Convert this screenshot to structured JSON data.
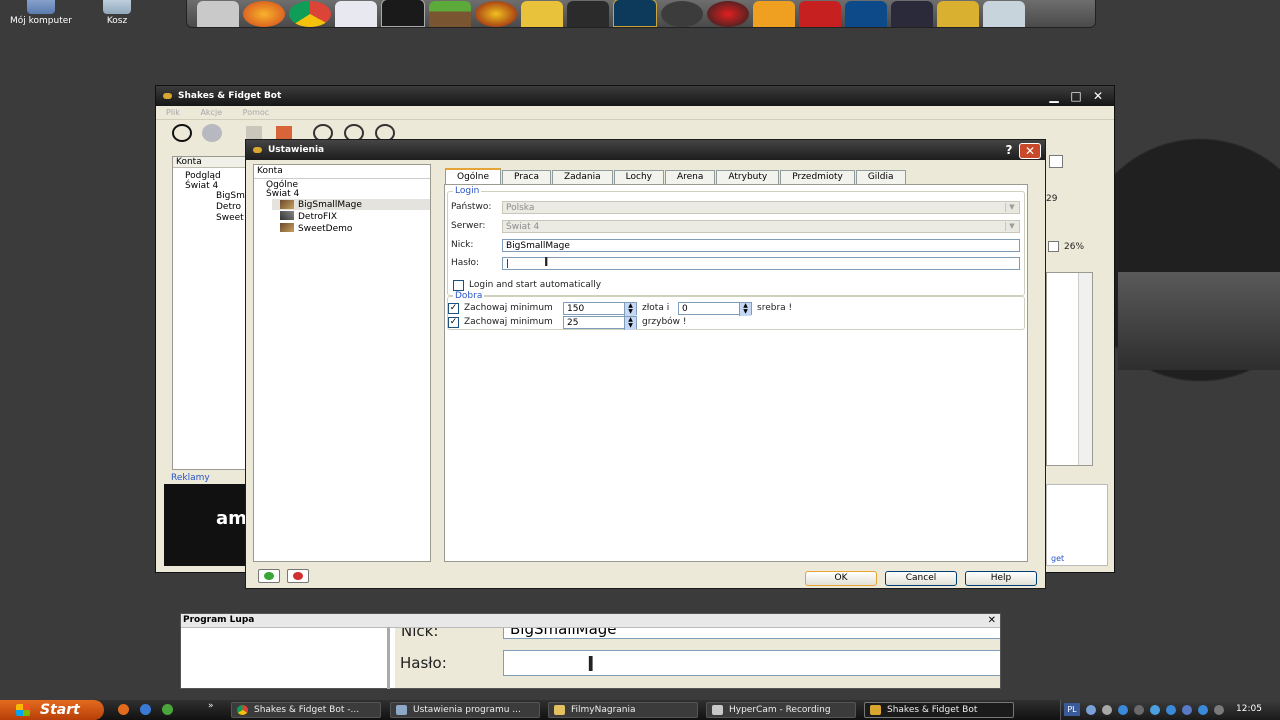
{
  "desktop": {
    "icons": [
      {
        "label": "Mój komputer"
      },
      {
        "label": "Kosz"
      }
    ],
    "dock_icons": [
      "text-editor-icon",
      "firefox-icon",
      "chrome-icon",
      "calendar-icon",
      "terminal-icon",
      "minecraft-icon",
      "borderlands-icon",
      "counter-strike-icon",
      "skull-game-icon",
      "league-of-legends-icon",
      "steam-icon",
      "record-icon",
      "fl-studio-icon",
      "flash-icon",
      "photoshop-icon",
      "monitor-icon",
      "folder-tools-icon",
      "trash-icon"
    ]
  },
  "main_window": {
    "title": "Shakes & Fidget Bot",
    "menu": [
      "Plik",
      "Akcje",
      "Pomoc"
    ],
    "accounts_header": "Konta",
    "tree": [
      "Podgląd",
      "Świat 4",
      "BigSm",
      "Detro",
      "Sweet"
    ],
    "ads_label": "Reklamy",
    "ad_text": "am",
    "right_values": {
      "level": "29",
      "percent": "26%"
    },
    "ad_right_text": "get"
  },
  "dialog": {
    "title": "Ustawienia",
    "help_glyph": "?",
    "tree": {
      "root": "Konta",
      "general": "Ogólne",
      "world": "Świat 4",
      "accounts": [
        "BigSmallMage",
        "DetroFIX",
        "SweetDemo"
      ]
    },
    "tabs": [
      "Ogólne",
      "Praca",
      "Zadania",
      "Lochy",
      "Arena",
      "Atrybuty",
      "Przedmioty",
      "Gildia"
    ],
    "active_tab": "Ogólne",
    "login_group": {
      "title": "Login",
      "country_label": "Państwo:",
      "country_value": "Polska",
      "server_label": "Serwer:",
      "server_value": "Świat 4",
      "nick_label": "Nick:",
      "nick_value": "BigSmallMage",
      "password_label": "Hasło:",
      "password_value": "|",
      "auto_login_label": "Login and start automatically",
      "auto_login_checked": false
    },
    "goods_group": {
      "title": "Dobra",
      "row1": {
        "checked": true,
        "label": "Zachowaj minimum",
        "value1": "150",
        "sep": "złota i",
        "value2": "0",
        "suffix": "srebra !"
      },
      "row2": {
        "checked": true,
        "label": "Zachowaj minimum",
        "value1": "25",
        "suffix": "grzybów !"
      }
    },
    "buttons": {
      "ok": "OK",
      "cancel": "Cancel",
      "help": "Help"
    }
  },
  "magnifier": {
    "title": "Program Lupa",
    "nick_text": "Nick:",
    "nick_value": "BigSmallMage",
    "password_label": "Hasło:"
  },
  "taskbar": {
    "start": "Start",
    "tasks": [
      {
        "label": "Shakes & Fidget Bot -..."
      },
      {
        "label": "Ustawienia programu ..."
      },
      {
        "label": "FilmyNagrania"
      },
      {
        "label": "HyperCam - Recording"
      },
      {
        "label": "Shakes & Fidget Bot"
      }
    ],
    "language": "PL",
    "clock": "12:05"
  },
  "colors": {
    "accent_orange": "#e6a434",
    "link_blue": "#2a55c8",
    "start_orange": "#d9561a"
  }
}
